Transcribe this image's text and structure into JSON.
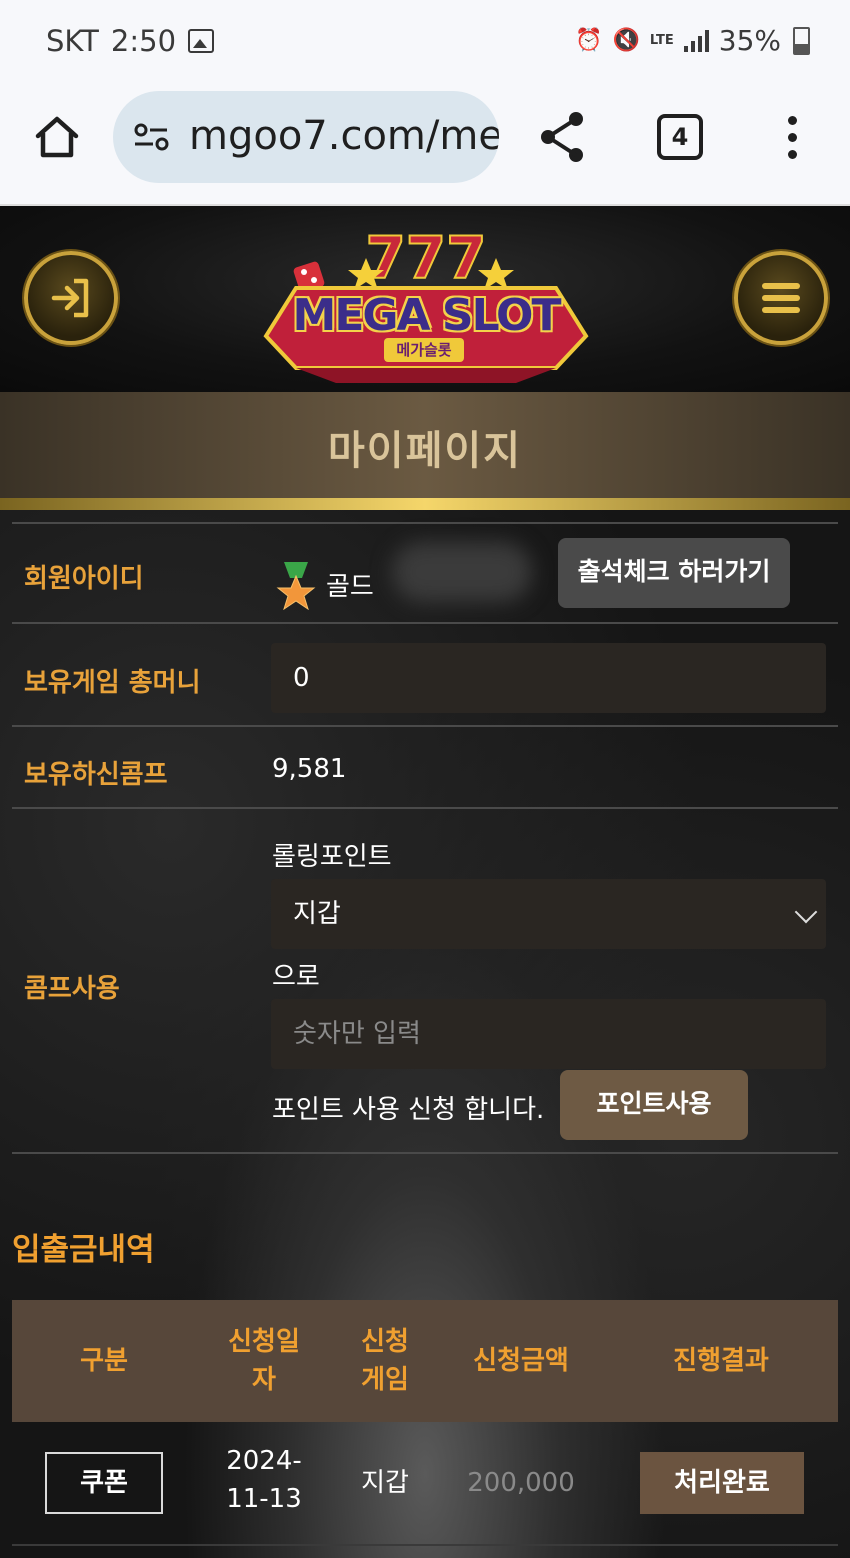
{
  "status_bar": {
    "carrier": "SKT",
    "time": "2:50",
    "network": "LTE",
    "battery": "35%"
  },
  "browser": {
    "url": "mgoo7.com/me",
    "tab_count": "4"
  },
  "site": {
    "logo_text": "MEGA SLOT",
    "logo_subtext": "메가슬롯"
  },
  "page": {
    "title": "마이페이지"
  },
  "profile": {
    "member_id_label": "회원아이디",
    "grade": "골드",
    "attendance_button": "출석체크 하러가기",
    "game_money_label": "보유게임 총머니",
    "game_money_value": "0",
    "comp_label": "보유하신콤프",
    "comp_value": "9,581"
  },
  "comp_use": {
    "label": "콤프사용",
    "rolling_label": "롤링포인트",
    "target_select": "지갑",
    "to_label": "으로",
    "amount_placeholder": "숫자만 입력",
    "apply_text": "포인트 사용 신청 합니다.",
    "apply_button": "포인트사용"
  },
  "history": {
    "title": "입출금내역",
    "columns": [
      "구분",
      "신청일\n자",
      "신청\n게임",
      "신청금액",
      "진행결과"
    ],
    "rows": [
      {
        "type": "쿠폰",
        "date": "2024-\n11-13",
        "game": "지갑",
        "amount": "200,000",
        "result": "처리완료"
      }
    ]
  }
}
